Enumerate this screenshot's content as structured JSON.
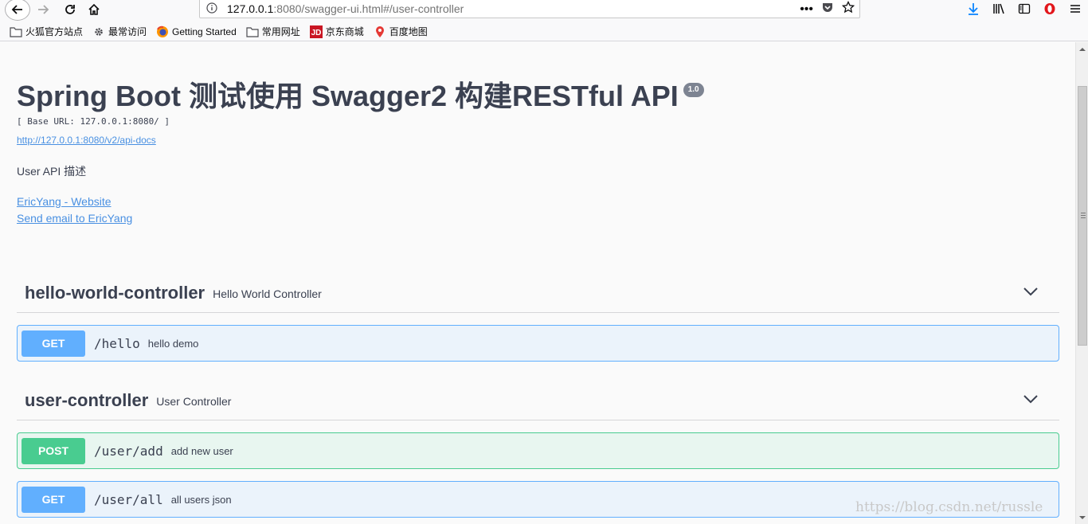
{
  "browser": {
    "url_host": "127.0.0.1",
    "url_rest": ":8080/swagger-ui.html#/user-controller",
    "bookmarks": [
      {
        "label": "火狐官方站点",
        "icon": "folder-icon"
      },
      {
        "label": "最常访问",
        "icon": "gear-icon"
      },
      {
        "label": "Getting Started",
        "icon": "firefox-icon"
      },
      {
        "label": "常用网址",
        "icon": "folder-icon"
      },
      {
        "label": "京东商城",
        "icon": "jd-logo-icon"
      },
      {
        "label": "百度地图",
        "icon": "map-pin-icon"
      }
    ]
  },
  "info": {
    "title": "Spring Boot 测试使用 Swagger2 构建RESTful API",
    "version": "1.0",
    "base_url": "[ Base URL: 127.0.0.1:8080/ ]",
    "api_docs_link": "http://127.0.0.1:8080/v2/api-docs",
    "description": "User API 描述",
    "website_link": "EricYang - Website",
    "email_link": "Send email to EricYang"
  },
  "tags": [
    {
      "name": "hello-world-controller",
      "description": "Hello World Controller",
      "operations": [
        {
          "method": "GET",
          "path": "/hello",
          "summary": "hello demo"
        }
      ]
    },
    {
      "name": "user-controller",
      "description": "User Controller",
      "operations": [
        {
          "method": "POST",
          "path": "/user/add",
          "summary": "add new user"
        },
        {
          "method": "GET",
          "path": "/user/all",
          "summary": "all users json"
        }
      ]
    }
  ],
  "watermark": "https://blog.csdn.net/russle",
  "colors": {
    "get": "#61affe",
    "post": "#49cc90",
    "link": "#4990e2",
    "text": "#3b4151"
  }
}
